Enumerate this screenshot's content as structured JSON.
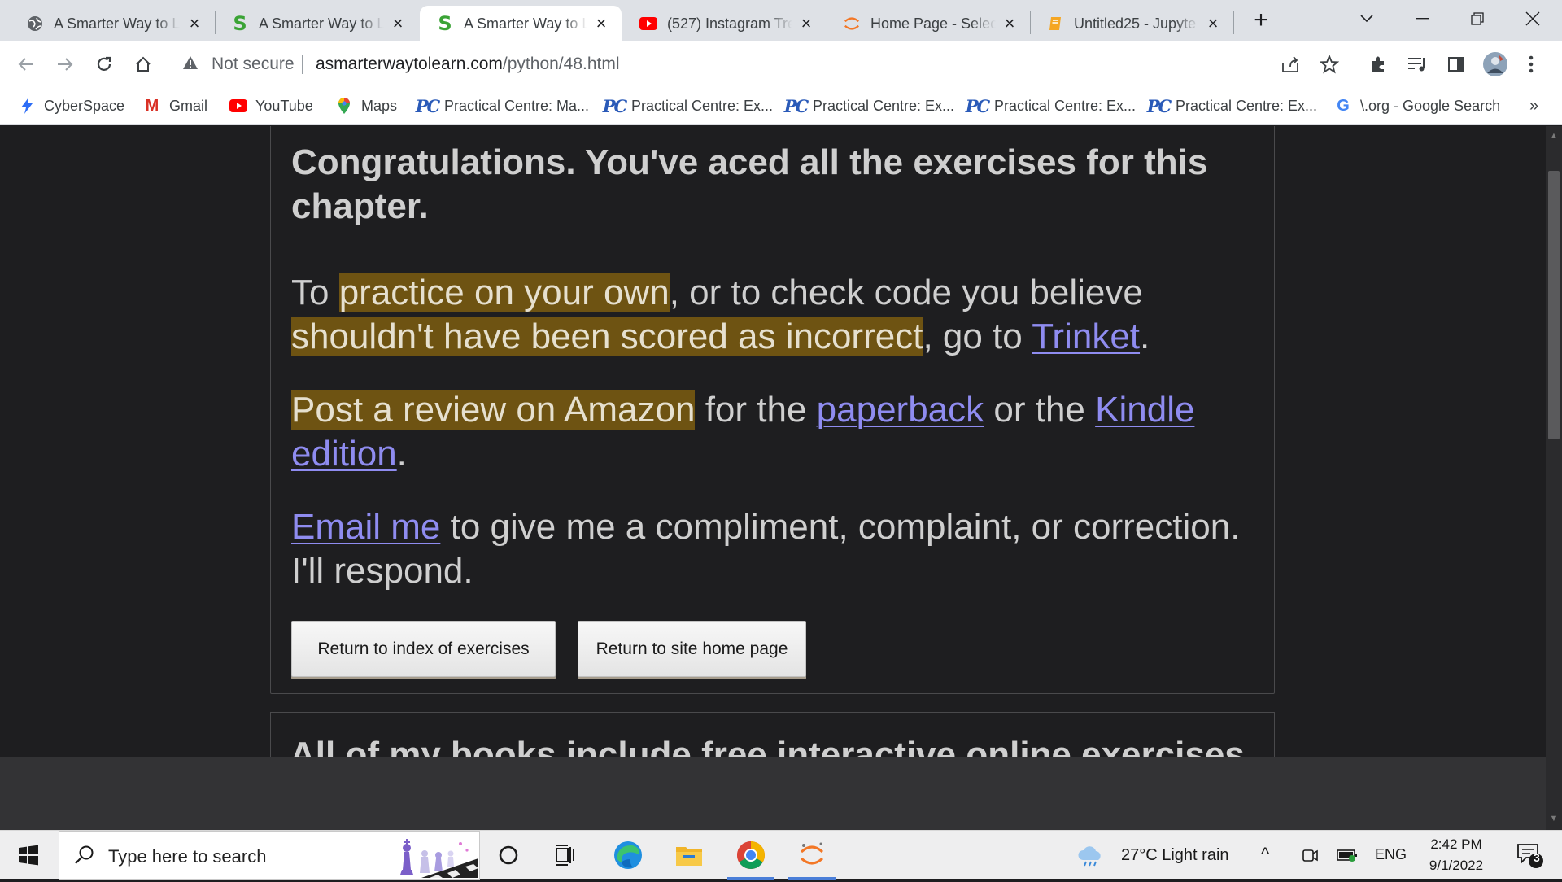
{
  "browser": {
    "tabs": [
      {
        "title": "A Smarter Way to L",
        "icon": "globe-icon"
      },
      {
        "title": "A Smarter Way to L",
        "icon": "green-s-icon"
      },
      {
        "title": "A Smarter Way to L",
        "icon": "green-s-icon",
        "active": true
      },
      {
        "title": "(527) Instagram Tre",
        "icon": "youtube-icon"
      },
      {
        "title": "Home Page - Select",
        "icon": "jupyter-icon"
      },
      {
        "title": "Untitled25 - Jupyte",
        "icon": "notebook-icon"
      }
    ],
    "new_tab": "+",
    "security_label": "Not secure",
    "url_host": "asmarterwaytolearn.com",
    "url_path": "/python/48.html",
    "bookmarks": [
      {
        "label": "CyberSpace",
        "icon": "lightning-icon"
      },
      {
        "label": "Gmail",
        "icon": "gmail-icon"
      },
      {
        "label": "YouTube",
        "icon": "youtube-icon"
      },
      {
        "label": "Maps",
        "icon": "maps-pin-icon"
      },
      {
        "label": "Practical Centre: Ma...",
        "icon": "pc-logo-icon"
      },
      {
        "label": "Practical Centre: Ex...",
        "icon": "pc-logo-icon"
      },
      {
        "label": "Practical Centre: Ex...",
        "icon": "pc-logo-icon"
      },
      {
        "label": "Practical Centre: Ex...",
        "icon": "pc-logo-icon"
      },
      {
        "label": "Practical Centre: Ex...",
        "icon": "pc-logo-icon"
      },
      {
        "label": "\\.org - Google Search",
        "icon": "google-icon"
      }
    ],
    "bookmarks_more": "»",
    "pc_logo_text": "PC",
    "google_letter": "G",
    "gmail_letter": "M"
  },
  "page": {
    "headline": "Congratulations. You've aced all the exercises for this chapter.",
    "p1": {
      "t1": "To ",
      "hl1": "practice on your own",
      "t2": ", or to check code you believe ",
      "hl2": "shouldn't have been scored as incorrect",
      "t3": ", go to ",
      "link": "Trinket",
      "t4": "."
    },
    "p2": {
      "hl": "Post a review on Amazon",
      "t1": " for the ",
      "link1": "paperback",
      "t2": " or the ",
      "link2": "Kindle edition",
      "t3": "."
    },
    "p3": {
      "link": "Email me",
      "t1": " to give me a compliment, complaint, or correction. I'll respond."
    },
    "btn_index": "Return to index of exercises",
    "btn_home": "Return to site home page",
    "teaser": "All of my books include free interactive online exercises"
  },
  "taskbar": {
    "search_placeholder": "Type here to search",
    "weather": "27°C  Light rain",
    "lang": "ENG",
    "time": "2:42 PM",
    "date": "9/1/2022",
    "notif_count": "3"
  },
  "colors": {
    "page_bg": "#1e1e20",
    "highlight": "#6e5312",
    "link": "#8f8cf0",
    "text": "#cfcfcf"
  }
}
